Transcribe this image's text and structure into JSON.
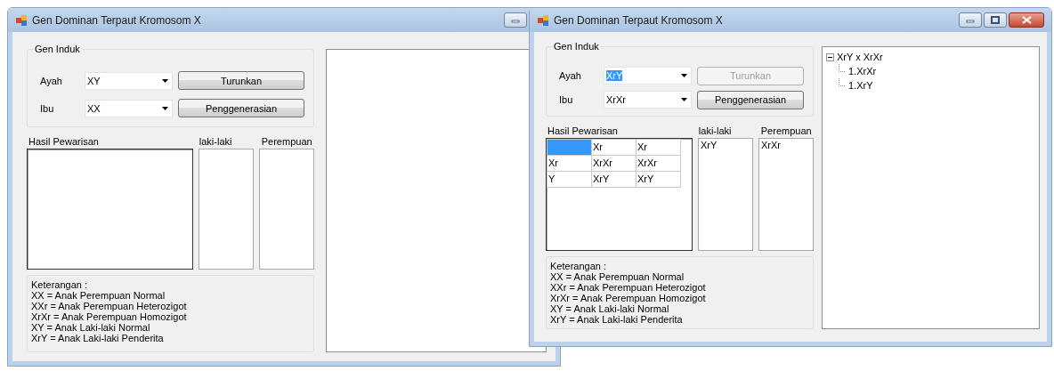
{
  "windows": [
    {
      "title": "Gen Dominan Terpaut Kromosom X",
      "title_buttons": [
        {
          "kind": "minimize"
        }
      ],
      "group": {
        "title": "Gen Induk",
        "fields": [
          {
            "label": "Ayah",
            "value": "XY",
            "selected": false
          },
          {
            "label": "Ibu",
            "value": "XX",
            "selected": false
          }
        ],
        "buttons": [
          {
            "label": "Turunkan",
            "disabled": false
          },
          {
            "label": "Penggenerasian",
            "disabled": false
          }
        ]
      },
      "hasil_label": "Hasil Pewarisan",
      "laki_label": "laki-laki",
      "perempuan_label": "Perempuan",
      "keterangan": [
        "Keterangan :",
        "XX = Anak Perempuan Normal",
        "XXr = Anak Perempuan Heterozigot",
        "XrXr = Anak Perempuan Homozigot",
        "XY = Anak Laki-laki Normal",
        "XrY = Anak Laki-laki Penderita"
      ]
    },
    {
      "title": "Gen Dominan Terpaut Kromosom X",
      "title_buttons": [
        {
          "kind": "minimize"
        },
        {
          "kind": "maximize"
        },
        {
          "kind": "close"
        }
      ],
      "group": {
        "title": "Gen Induk",
        "fields": [
          {
            "label": "Ayah",
            "value": "XrY",
            "selected": true
          },
          {
            "label": "Ibu",
            "value": "XrXr",
            "selected": false
          }
        ],
        "buttons": [
          {
            "label": "Turunkan",
            "disabled": true
          },
          {
            "label": "Penggenerasian",
            "disabled": false
          }
        ]
      },
      "hasil_label": "Hasil Pewarisan",
      "grid": [
        [
          {
            "selected": true
          },
          {
            "text": "Xr",
            "selected": false
          },
          {
            "text": "Xr",
            "selected": false
          }
        ],
        [
          {
            "text": "Xr",
            "selected": false
          },
          {
            "text": "XrXr",
            "selected": false
          },
          {
            "text": "XrXr",
            "selected": false
          }
        ],
        [
          {
            "text": "Y",
            "selected": false
          },
          {
            "text": "XrY",
            "selected": false
          },
          {
            "text": "XrY",
            "selected": false
          }
        ]
      ],
      "laki_label": "laki-laki",
      "laki_items": [
        "XrY"
      ],
      "perempuan_label": "Perempuan",
      "perempuan_items": [
        "XrXr"
      ],
      "keterangan": [
        "Keterangan :",
        "XX = Anak Perempuan Normal",
        "XXr = Anak Perempuan Heterozigot",
        "XrXr = Anak Perempuan Homozigot",
        "XY = Anak Laki-laki Normal",
        "XrY = Anak Laki-laki Penderita"
      ],
      "tree": [
        {
          "text": "XrY  x XrXr",
          "expanded": true,
          "children": [
            {
              "text": "1.XrXr"
            },
            {
              "text": "1.XrY"
            }
          ]
        }
      ]
    }
  ]
}
